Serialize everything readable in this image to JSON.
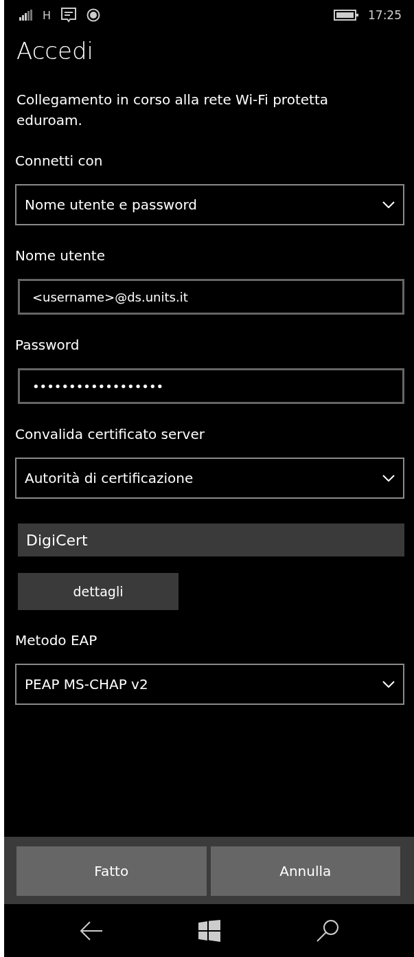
{
  "status_bar": {
    "network": "H",
    "time": "17:25"
  },
  "title": "Accedi",
  "description": "Collegamento in corso alla rete Wi-Fi protetta eduroam.",
  "form": [
    {
      "kind": "select",
      "label": "Connetti con",
      "value": "Nome utente e password"
    },
    {
      "kind": "input",
      "label": "Nome utente",
      "value": "<username>@ds.units.it"
    },
    {
      "kind": "input",
      "label": "Password",
      "value": "••••••••••••••••••"
    },
    {
      "kind": "select",
      "label": "Convalida certificato server",
      "value": "Autorità di certificazione"
    },
    {
      "kind": "readonly",
      "value": "DigiCert"
    },
    {
      "kind": "button",
      "label": "dettagli"
    },
    {
      "kind": "select",
      "label": "Metodo EAP",
      "value": "PEAP MS-CHAP v2"
    }
  ],
  "buttons": [
    "Fatto",
    "Annulla"
  ]
}
